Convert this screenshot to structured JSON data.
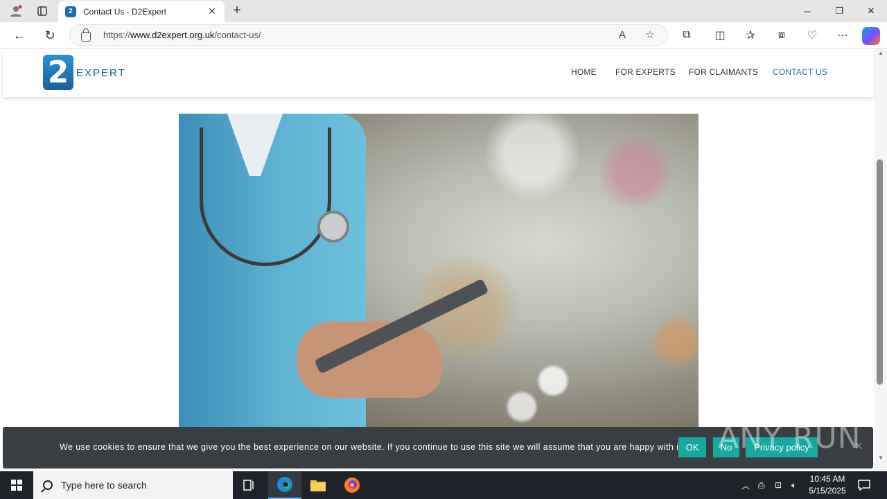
{
  "browser": {
    "tab_title": "Contact Us - D2Expert",
    "tab_favicon": "2",
    "url_prefix": "https://",
    "url_domain": "www.d2expert.org.uk",
    "url_path": "/contact-us/"
  },
  "site": {
    "logo_mark": "2",
    "logo_text": "EXPERT",
    "menu": [
      {
        "label": "HOME"
      },
      {
        "label": "FOR EXPERTS"
      },
      {
        "label": "FOR CLAIMANTS"
      },
      {
        "label": "CONTACT US"
      }
    ],
    "active_color": "#2a6f97"
  },
  "cookie": {
    "text": "We use cookies to ensure that we give you the best experience on our website. If you continue to use this site we will assume that you are happy with it.",
    "ok": "OK",
    "no": "No",
    "privacy": "Privacy policy",
    "button_color": "#17a8a0"
  },
  "watermark": "ANY RUN",
  "taskbar": {
    "search_placeholder": "Type here to search",
    "time": "10:45 AM",
    "date": "5/15/2025"
  }
}
